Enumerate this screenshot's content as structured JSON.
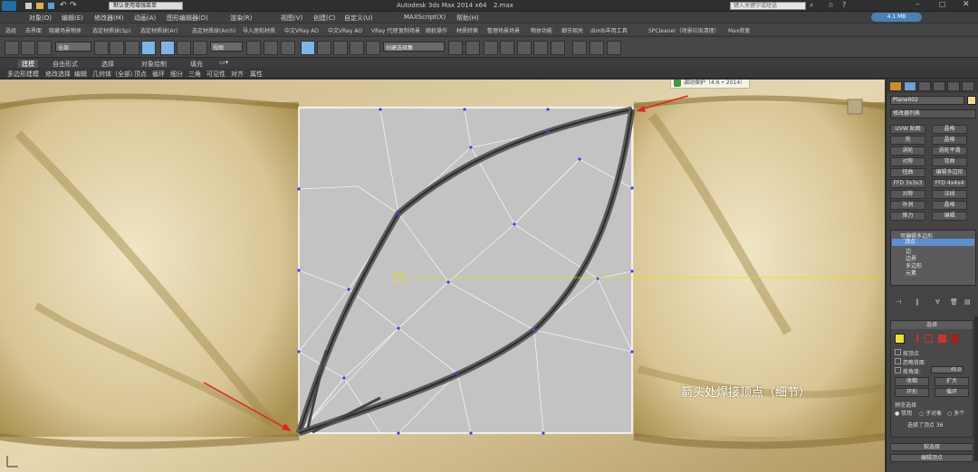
{
  "title": {
    "workspace": "默认使用增强菜单",
    "app": "Autodesk 3ds Max  2014 x64",
    "file": "2.max",
    "search_placeholder": "键入关键字或短语",
    "badge": "4.1 MB"
  },
  "menu": [
    "对象(O)",
    "编辑(E)",
    "修改器(M)",
    "动画(A)",
    "图形编辑器(D)",
    "渲染(R)",
    "视图(V)",
    "创建(C)",
    "自定义(U)",
    "MAXScript(X)",
    "帮助(H)"
  ],
  "quickbar": [
    "选组",
    "去界面",
    "隐藏场景物体",
    "选定材质球(Sp)",
    "选定材质球(Ar)",
    "选定材质球(Arch)",
    "导入居粘材质",
    "中文VRay AO",
    "中文VRay AO",
    "VRay 代理",
    "复制场景",
    "随机操作",
    "材质转换",
    "整理场景场景",
    "物体功能",
    "细节相关",
    "dimlb丰用工具",
    "SPCleaner（场景垃圾清理）",
    "Max修复"
  ],
  "toolbar": {
    "filter": "全部",
    "view": "视图",
    "selection_set": "创建选择集"
  },
  "ribbon": {
    "tabs": [
      "建模",
      "自由形式",
      "选择",
      "对象绘制",
      "填充"
    ],
    "subtabs": [
      "多边形建模",
      "修改选择",
      "编辑",
      "几何体（全部）",
      "顶点",
      "循环",
      "细分",
      "三角",
      "可见性",
      "对齐",
      "属性"
    ]
  },
  "viewport": {
    "tooltip": "调动保护（4.6 • 2014）",
    "caption": "箭头处焊接顶点（细节）"
  },
  "panel": {
    "object_name": "Plane002",
    "modifier_list": "修改器列表",
    "buttons": [
      [
        "UVW 贴图",
        "晶格"
      ],
      [
        "壳",
        "晶格"
      ],
      [
        "涡轮",
        "涡轮平滑"
      ],
      [
        "对称",
        "弯曲"
      ],
      [
        "扭曲",
        "编辑多边形"
      ],
      [
        "FFD 3x3x3",
        "FFD 4x4x4"
      ],
      [
        "对称",
        "法线"
      ],
      [
        "补洞",
        "晶格"
      ],
      [
        "推力",
        "编辑"
      ]
    ],
    "stack_title": "可编辑多边形",
    "stack_items": [
      "顶点",
      "边",
      "边界",
      "多边形",
      "元素"
    ],
    "selection_title": "选择",
    "checks": [
      "按顶点",
      "忽略背面",
      "按角度:"
    ],
    "angle_value": "45.0",
    "shrink": "收缩",
    "grow": "扩大",
    "ring": "环形",
    "loop": "循环",
    "preview_title": "预览选择",
    "preview_opts": [
      "禁用",
      "子对象",
      "多个"
    ],
    "selected_status": "选择了顶点 36",
    "soft_selection": "软选择",
    "edit_vertices": "编辑顶点"
  }
}
